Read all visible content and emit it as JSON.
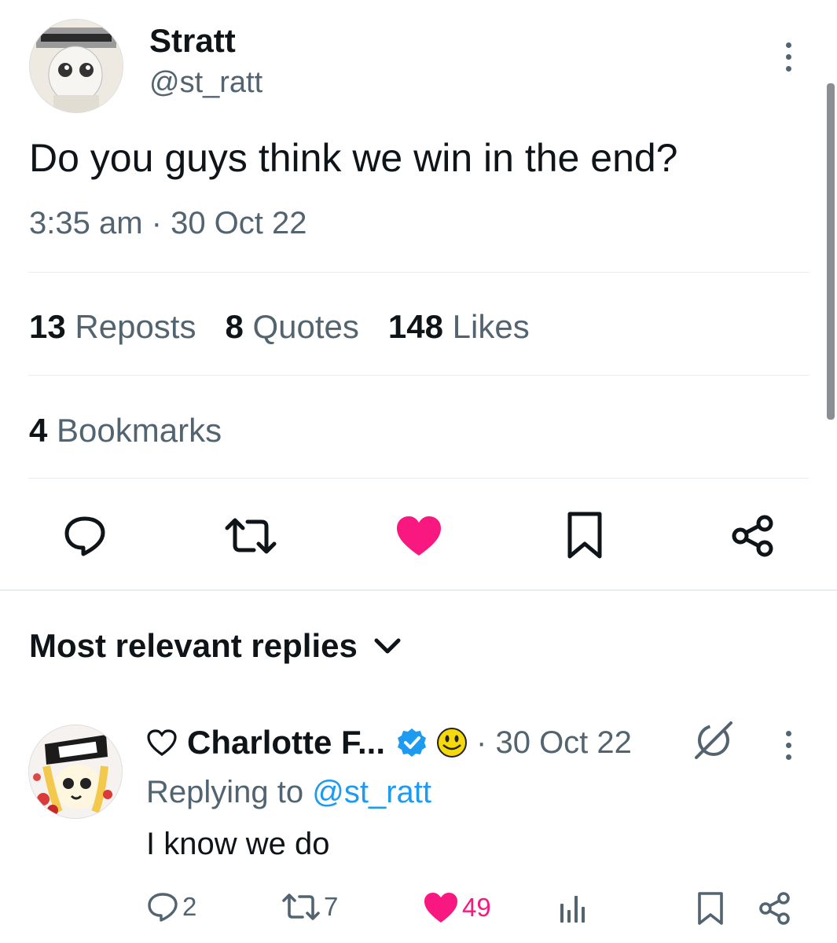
{
  "tweet": {
    "display_name": "Stratt",
    "handle": "@st_ratt",
    "text": "Do you guys think we win in the end?",
    "timestamp": "3:35 am · 30 Oct 22",
    "stats": {
      "reposts_count": "13",
      "reposts_label": "Reposts",
      "quotes_count": "8",
      "quotes_label": "Quotes",
      "likes_count": "148",
      "likes_label": "Likes",
      "bookmarks_count": "4",
      "bookmarks_label": "Bookmarks"
    },
    "liked": true,
    "actions": [
      "reply-icon",
      "repost-icon",
      "like-icon",
      "bookmark-icon",
      "share-icon"
    ]
  },
  "replies_section": {
    "title": "Most relevant replies"
  },
  "reply": {
    "display_name": "Charlotte F...",
    "date": "· 30 Oct 22",
    "replying_prefix": "Replying to",
    "replying_handle": "@st_ratt",
    "text": "I know we do",
    "replies_count": "2",
    "reposts_count": "7",
    "likes_count": "49",
    "verified": true
  },
  "colors": {
    "like_pink": "#f91880",
    "link_blue": "#1d9bf0",
    "secondary_text": "#536471",
    "divider": "#e6ecf0"
  }
}
